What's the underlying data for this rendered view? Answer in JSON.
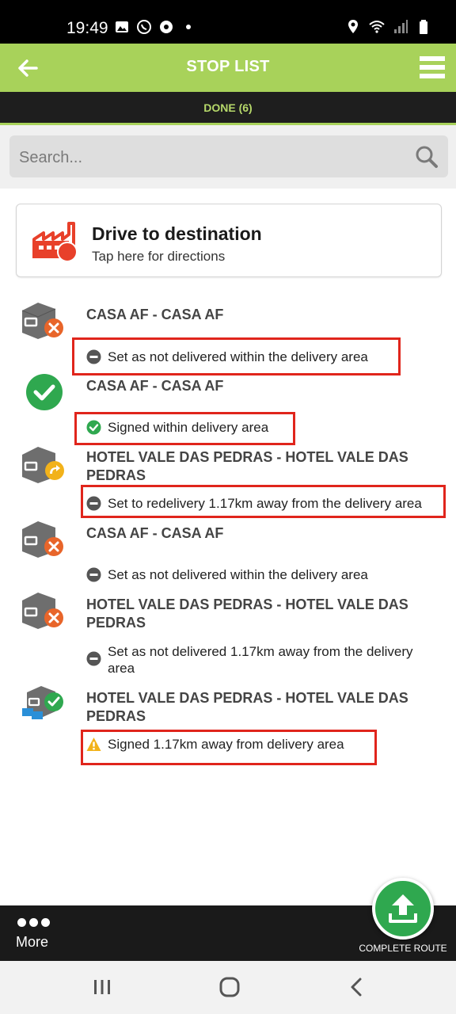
{
  "status_bar": {
    "time": "19:49",
    "left_icons": [
      "gallery-icon",
      "whatsapp-icon",
      "ball-icon",
      "dot-icon"
    ],
    "right_icons": [
      "location-icon",
      "wifi-icon",
      "signal-icon",
      "battery-icon"
    ]
  },
  "app_bar": {
    "title": "STOP LIST"
  },
  "tab": {
    "label": "DONE (6)"
  },
  "search": {
    "placeholder": "Search..."
  },
  "destination": {
    "title": "Drive to destination",
    "subtitle": "Tap here for directions"
  },
  "stops": [
    {
      "title": "CASA AF - CASA AF",
      "status": "Set as not delivered within the delivery area",
      "status_kind": "not-delivered",
      "icon": "box-x-icon"
    },
    {
      "title": "CASA AF - CASA AF",
      "status": "Signed within delivery area",
      "status_kind": "signed",
      "icon": "check-circle-icon"
    },
    {
      "title": "HOTEL VALE DAS PEDRAS - HOTEL VALE DAS PEDRAS",
      "status": "Set to redelivery 1.17km away from the delivery area",
      "status_kind": "redelivery",
      "icon": "box-redelivery-icon"
    },
    {
      "title": "CASA AF - CASA AF",
      "status": "Set as not delivered within the delivery area",
      "status_kind": "not-delivered",
      "icon": "box-x-icon"
    },
    {
      "title": "HOTEL VALE DAS PEDRAS - HOTEL VALE DAS PEDRAS",
      "status": "Set as not delivered 1.17km away from the delivery area",
      "status_kind": "not-delivered",
      "icon": "box-x-icon"
    },
    {
      "title": "HOTEL VALE DAS PEDRAS - HOTEL VALE DAS PEDRAS",
      "status": "Signed 1.17km away from delivery area",
      "status_kind": "warning",
      "icon": "box-signed-icon"
    }
  ],
  "bottom_bar": {
    "more_label": "More",
    "complete_label": "COMPLETE ROUTE"
  },
  "colors": {
    "accent": "#a8d25a",
    "highlight": "#e0251c",
    "success": "#2fa84f",
    "error": "#e8652a",
    "warning": "#f2b21a"
  }
}
